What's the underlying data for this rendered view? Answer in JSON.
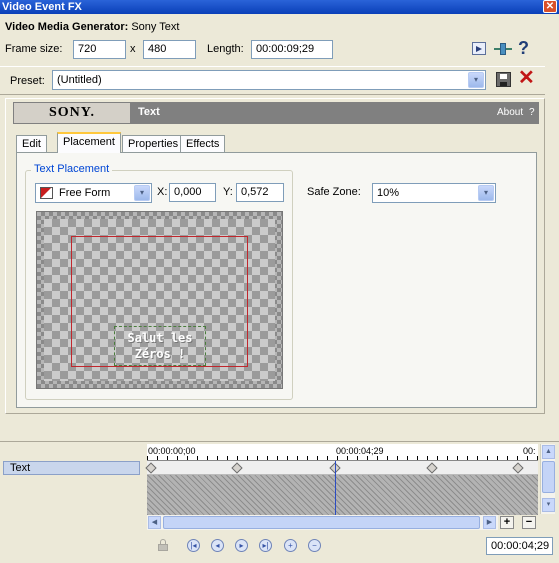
{
  "window": {
    "title": "Video Event FX",
    "close_glyph": "✕"
  },
  "generator": {
    "label": "Video Media Generator:",
    "name": "Sony Text"
  },
  "frame": {
    "label": "Frame size:",
    "width": "720",
    "x": "x",
    "height": "480",
    "length_label": "Length:",
    "length": "00:00:09;29"
  },
  "preset": {
    "label": "Preset:",
    "value": "(Untitled)"
  },
  "banner": {
    "brand": "SONY.",
    "plugin": "Text",
    "about": "About",
    "help": "?"
  },
  "tabs": [
    "Edit",
    "Placement",
    "Properties",
    "Effects"
  ],
  "placement": {
    "group_label": "Text Placement",
    "mode": "Free Form",
    "x_label": "X:",
    "x_value": "0,000",
    "y_label": "Y:",
    "y_value": "0,572",
    "safe_zone_label": "Safe Zone:",
    "safe_zone_value": "10%",
    "preview_line1": "Salut les",
    "preview_line2": "Zéros !"
  },
  "timeline": {
    "track_label": "Text",
    "ruler_start": "00:00:00;00",
    "ruler_mid": "00:00:04;29",
    "ruler_end": "00:",
    "current_time": "00:00:04;29",
    "keyframe_positions": [
      0,
      0.23,
      0.48,
      0.73,
      0.95
    ],
    "cursor_position": 0.48
  },
  "icons": {
    "arrow_down": "▾",
    "arrow_left": "◀",
    "arrow_right": "▶",
    "arrow_up": "▲",
    "plus": "+",
    "minus": "−",
    "help": "?"
  }
}
